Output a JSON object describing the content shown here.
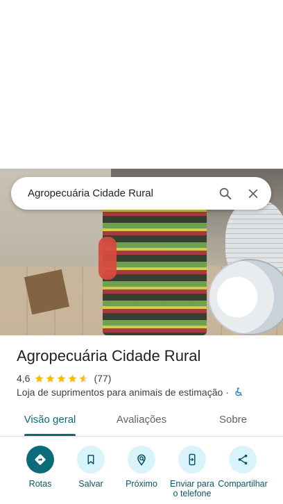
{
  "search": {
    "query": "Agropecuária Cidade Rural"
  },
  "place": {
    "name": "Agropecuária Cidade Rural",
    "rating": "4,6",
    "rating_value": 4.6,
    "review_count": "(77)",
    "category": "Loja de suprimentos para animais de estimação",
    "separator": "·"
  },
  "tabs": [
    {
      "label": "Visão geral",
      "active": true
    },
    {
      "label": "Avaliações",
      "active": false
    },
    {
      "label": "Sobre",
      "active": false
    }
  ],
  "actions": [
    {
      "label": "Rotas",
      "icon": "directions-icon"
    },
    {
      "label": "Salvar",
      "icon": "bookmark-icon"
    },
    {
      "label": "Próximo",
      "icon": "nearby-icon"
    },
    {
      "label": "Enviar para o telefone",
      "icon": "send-to-phone-icon"
    },
    {
      "label": "Compartilhar",
      "icon": "share-icon"
    }
  ],
  "colors": {
    "accent": "#0b6b7a",
    "star": "#fbbc04",
    "action_bg": "#d9f3fb",
    "a11y": "#1a73e8"
  }
}
